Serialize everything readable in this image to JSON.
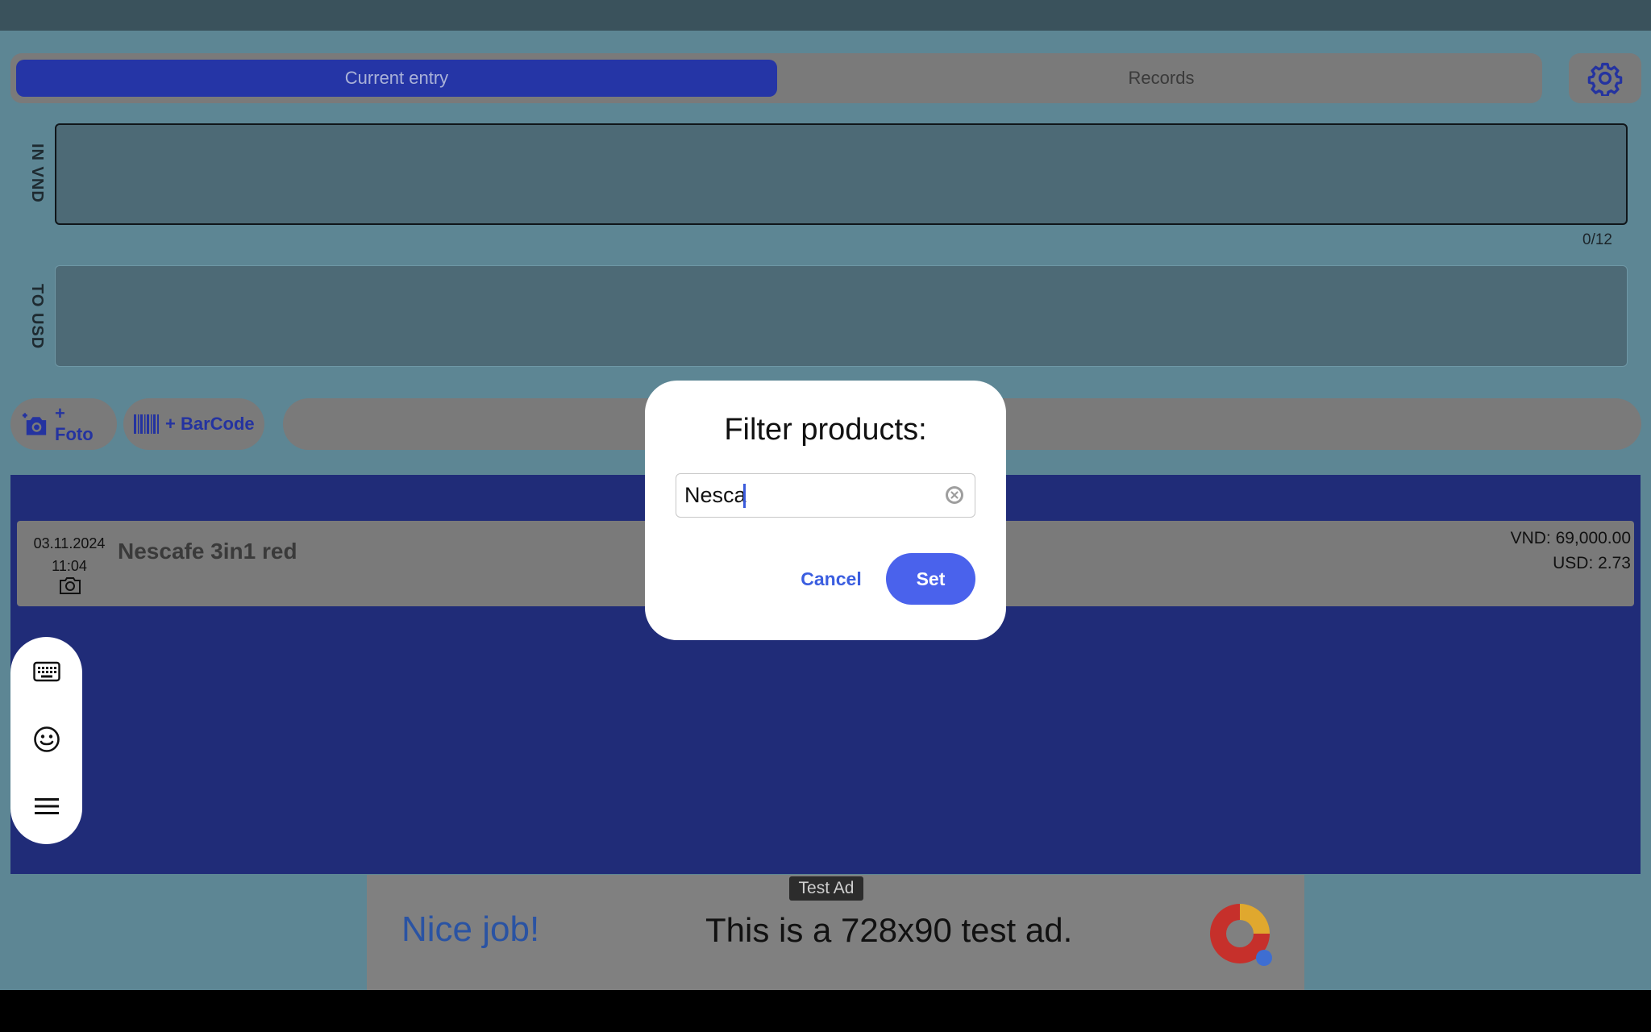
{
  "tabs": {
    "current": "Current entry",
    "records": "Records"
  },
  "fields": {
    "in_label": "IN VND",
    "to_label": "TO USD",
    "counter": "0/12"
  },
  "actions": {
    "foto": "+ Foto",
    "barcode": "+ BarCode"
  },
  "record": {
    "date": "03.11.2024",
    "time": "11:04",
    "name": "Nescafe 3in1 red",
    "vnd": "VND: 69,000.00",
    "usd": "USD: 2.73"
  },
  "floating_toolbar": {
    "icons": [
      "keyboard-icon",
      "emoji-icon",
      "menu-icon"
    ]
  },
  "ad": {
    "label": "Test Ad",
    "headline": "Nice job!",
    "text": "This is a 728x90 test ad."
  },
  "dialog": {
    "title": "Filter products:",
    "input_value": "Nesca",
    "cancel_label": "Cancel",
    "set_label": "Set"
  },
  "colors": {
    "primary": "#2535a6",
    "dialog_button": "#4a62ec",
    "accent_text": "#3b5ee0"
  }
}
